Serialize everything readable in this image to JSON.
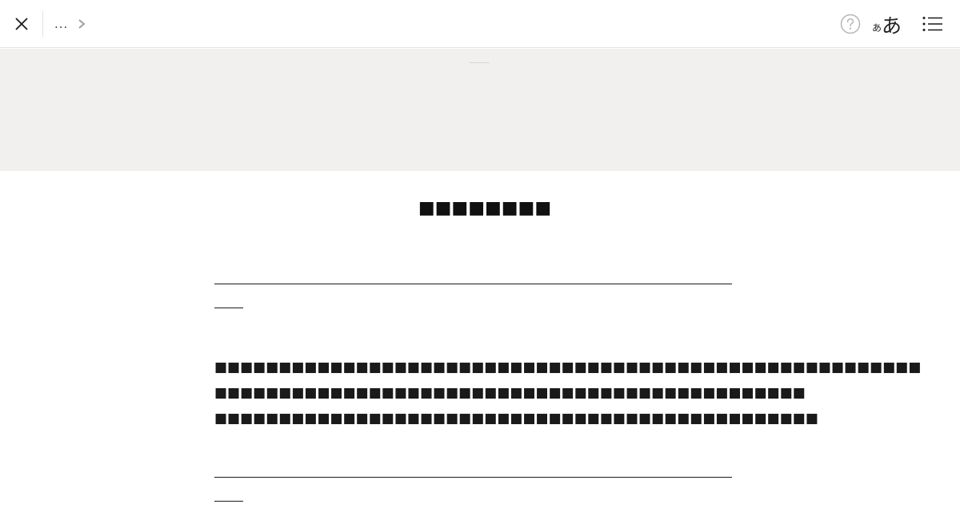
{
  "toolbar": {
    "close_icon": "close-icon",
    "breadcrumb_ellipsis": "...",
    "breadcrumb_chevron_icon": "chevron-right-icon",
    "help_icon": "help-circle-icon",
    "font_size_small": "あ",
    "font_size_large": "あ",
    "toc_icon": "list-icon"
  },
  "article": {
    "title": "■■■■■■■■",
    "paragraph_lines": [
      "■■■■■■■■■■■■■■■■■■■■■■■■■■■■■■■■■■■■■■■■■■■■■■■■■■■■■■■",
      "■■■■■■■■■■■■■■■■■■■■■■■■■■■■■■■■■■■■■■■■■■■■■■",
      "■■■■■■■■■■■■■■■■■■■■■■■■■■■■■■■■■■■■■■■■■■■■■■■"
    ]
  },
  "colors": {
    "hero_background": "#f1f0ee",
    "text": "#1a1a1a",
    "icon_muted": "#b5b5b5"
  }
}
